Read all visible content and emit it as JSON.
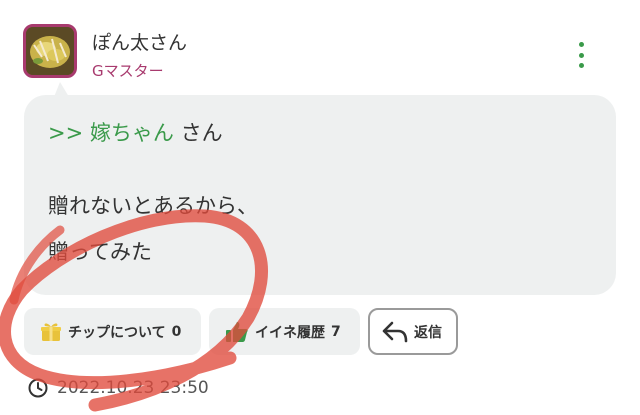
{
  "post": {
    "username": "ぽん太さん",
    "rank": "Gマスター",
    "reply_to": {
      "prefix": ">>",
      "name": "嫁ちゃん",
      "suffix": "さん"
    },
    "body_lines": [
      "贈れないとあるから、",
      "贈ってみた"
    ],
    "timestamp": "2022.10.23 23:50"
  },
  "actions": {
    "tip_label": "チップについて",
    "tip_count": "0",
    "nice_label": "イイネ履歴",
    "nice_count": "7",
    "reply_label": "返信"
  },
  "colors": {
    "accent_green": "#3a9a4a",
    "rank_magenta": "#a83a6e",
    "bubble_bg": "#eef0f0",
    "annotation_red": "#e04a3c"
  },
  "icons": {
    "menu": "kebab-menu-icon",
    "tip": "gift-icon",
    "nice": "thumbs-up-icon",
    "reply": "reply-arrow-icon",
    "time": "clock-icon"
  }
}
